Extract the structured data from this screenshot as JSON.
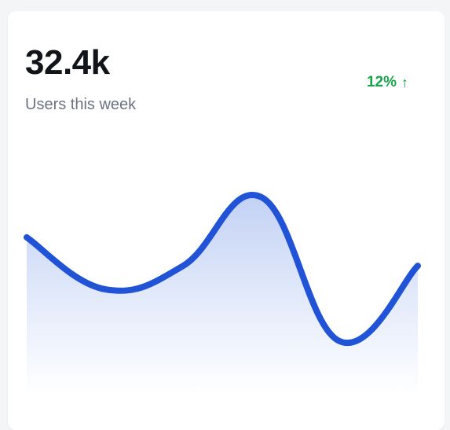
{
  "stat": {
    "value": "32.4k",
    "label": "Users this week",
    "trend_text": "12%",
    "trend_direction": "up",
    "trend_icon": "arrow-up-icon",
    "trend_color": "#16a34a"
  },
  "colors": {
    "line": "#2153d6",
    "fill_top": "#bfcff4",
    "fill_bottom": "#ffffff"
  },
  "chart_data": {
    "type": "area",
    "x": [
      0,
      1,
      2,
      3,
      4,
      5
    ],
    "values": [
      0.62,
      0.31,
      0.45,
      0.86,
      0.0,
      0.45
    ],
    "ylim": [
      0,
      1
    ],
    "grid": false,
    "legend": "none"
  }
}
